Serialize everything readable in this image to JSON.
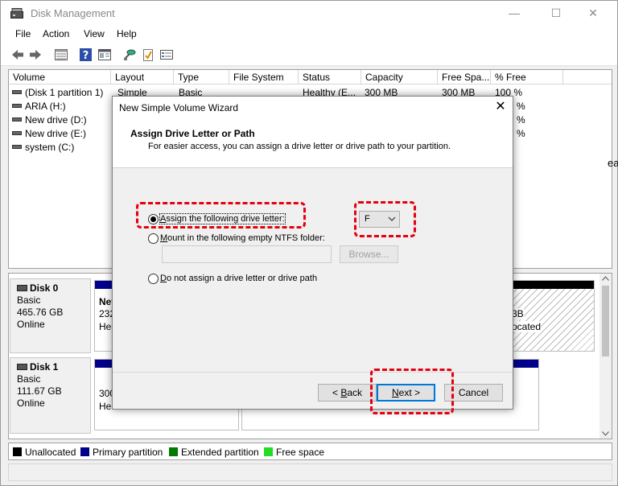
{
  "window": {
    "title": "Disk Management",
    "minimize": "—",
    "maximize": "☐",
    "close": "✕"
  },
  "menu": [
    "File",
    "Action",
    "View",
    "Help"
  ],
  "toolbar_icons": [
    "back-arrow-icon",
    "forward-arrow-icon",
    "disk-list-icon",
    "help-icon",
    "properties-icon",
    "connect-icon",
    "check-icon",
    "settings-list-icon"
  ],
  "columns": [
    "Volume",
    "Layout",
    "Type",
    "File System",
    "Status",
    "Capacity",
    "Free Spa...",
    "% Free"
  ],
  "volumes": [
    {
      "name": "(Disk 1 partition 1)",
      "layout": "Simple",
      "type": "Basic",
      "fs": "",
      "status": "Healthy (E...",
      "capacity": "300 MB",
      "free": "300 MB",
      "pct": "100 %"
    },
    {
      "name": "ARIA (H:)"
    },
    {
      "name": "New drive (D:)"
    },
    {
      "name": "New drive (E:)"
    },
    {
      "name": "system (C:)"
    }
  ],
  "volume_partial_text": {
    "pct1": "%",
    "pct2": "%",
    "pct3": "%",
    "side": "ea"
  },
  "disks": [
    {
      "name": "Disk 0",
      "type": "Basic",
      "size": "465.76 GB",
      "state": "Online",
      "partition_label": "Nev",
      "partition_size": "232",
      "partition_status": "Hea",
      "unalloc_size": "3B",
      "unalloc_label": "ocated"
    },
    {
      "name": "Disk 1",
      "type": "Basic",
      "size": "111.67 GB",
      "state": "Online",
      "partition_size": "300",
      "partition_status": "Hea"
    }
  ],
  "legend": [
    {
      "label": "Unallocated",
      "color": "#000000"
    },
    {
      "label": "Primary partition",
      "color": "#00008b"
    },
    {
      "label": "Extended partition",
      "color": "#007a00"
    },
    {
      "label": "Free space",
      "color": "#22dd22"
    }
  ],
  "dialog": {
    "title": "New Simple Volume Wizard",
    "heading": "Assign Drive Letter or Path",
    "subheading": "For easier access, you can assign a drive letter or drive path to your partition.",
    "options": {
      "assign_letter": {
        "prefix": "",
        "accel": "A",
        "rest": "ssign the following drive letter:",
        "checked": true
      },
      "mount_folder": {
        "accel": "M",
        "rest": "ount in the following empty NTFS folder:",
        "checked": false
      },
      "no_assign": {
        "accel": "D",
        "rest": "o not assign a drive letter or drive path",
        "checked": false
      }
    },
    "drive_letter": "F",
    "folder_path": "",
    "browse": "Browse...",
    "back": {
      "prefix": "< ",
      "accel": "B",
      "rest": "ack"
    },
    "next": {
      "accel": "N",
      "rest": "ext >"
    },
    "cancel": "Cancel",
    "close": "✕"
  },
  "highlight_color": "#e3000f"
}
